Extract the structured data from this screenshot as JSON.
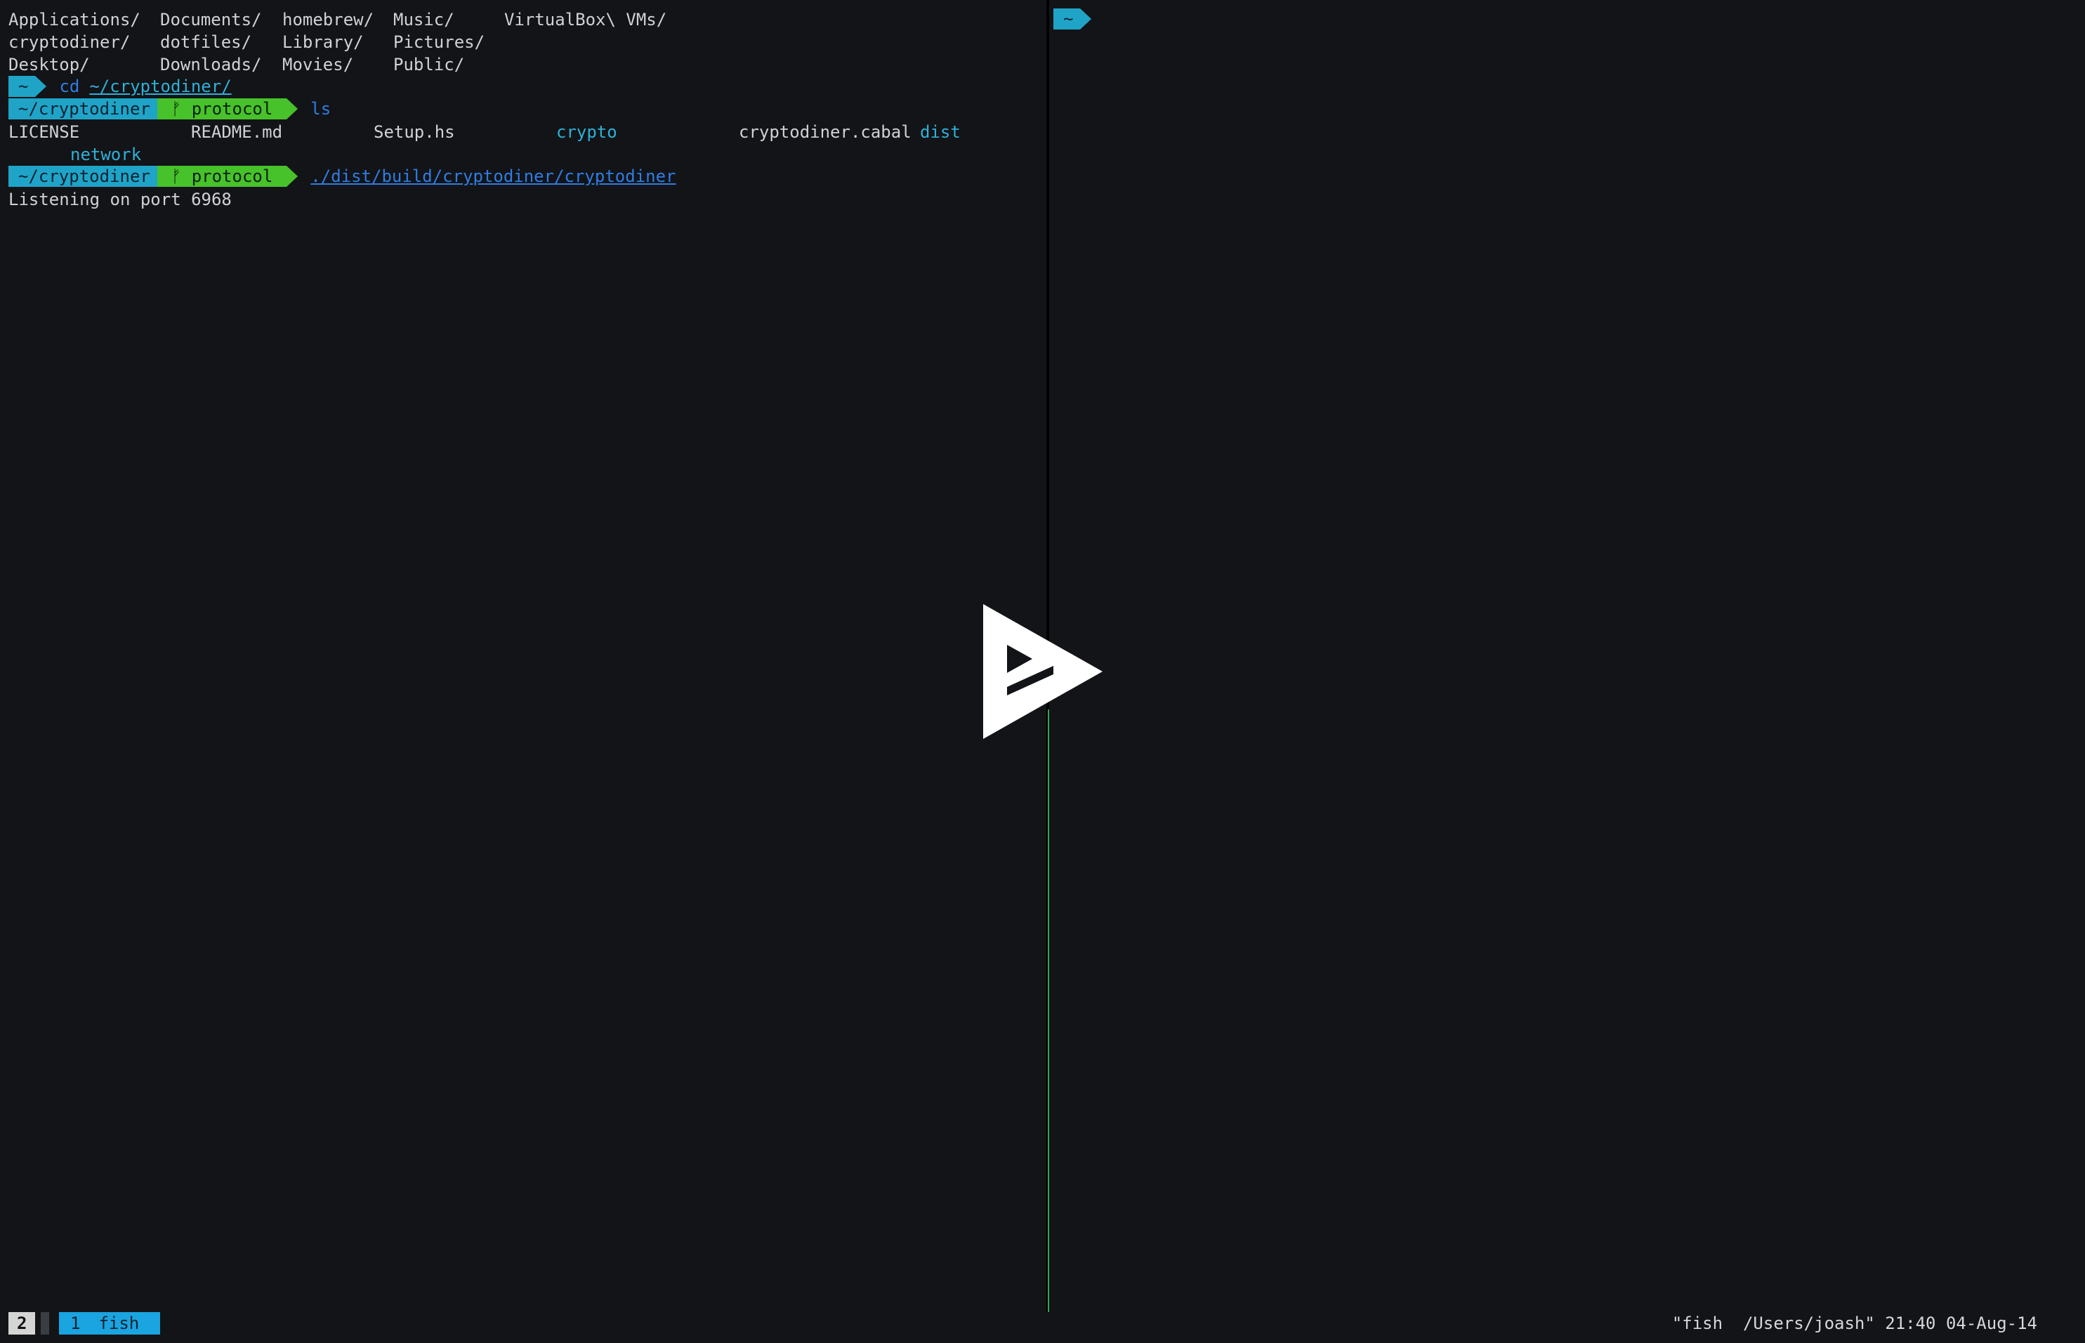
{
  "terminal": {
    "ls_home": {
      "row1": [
        "Applications/",
        "Documents/",
        "homebrew/",
        "Music/",
        "VirtualBox\\ VMs/"
      ],
      "row2": [
        "cryptodiner/",
        "dotfiles/",
        "Library/",
        "Pictures/"
      ],
      "row3": [
        "Desktop/",
        "Downloads/",
        "Movies/",
        "Public/"
      ]
    },
    "prompt_home": {
      "segment": "~",
      "command": "cd",
      "argument": "~/cryptodiner/"
    },
    "prompt_repo_1": {
      "dir_segment": "~/cryptodiner",
      "branch_icon": "ᚠ",
      "branch": "protocol",
      "command": "ls"
    },
    "ls_repo": {
      "row1": [
        "LICENSE",
        "README.md",
        "Setup.hs",
        "crypto",
        "cryptodiner.cabal",
        "dist"
      ],
      "row2": [
        "network"
      ]
    },
    "prompt_repo_2": {
      "dir_segment": "~/cryptodiner",
      "branch_icon": "ᚠ",
      "branch": "protocol",
      "command": "./dist/build/cryptodiner/cryptodiner"
    },
    "output": "Listening on port 6968"
  },
  "right_pane": {
    "segment": "~"
  },
  "overlay": {
    "icon": "asciinema-play-icon"
  },
  "status_bar": {
    "session_number": "2",
    "window_index": "1",
    "window_name": "fish",
    "right_text": "\"fish  /Users/joash\" 21:40 04-Aug-14"
  },
  "colors": {
    "background": "#121417",
    "cyan_segment": "#1fa4c8",
    "green_segment": "#47c22a",
    "command_blue": "#2f7de3",
    "directory_cyan": "#2fb0d8",
    "status_tab": "#1aa4e0"
  }
}
